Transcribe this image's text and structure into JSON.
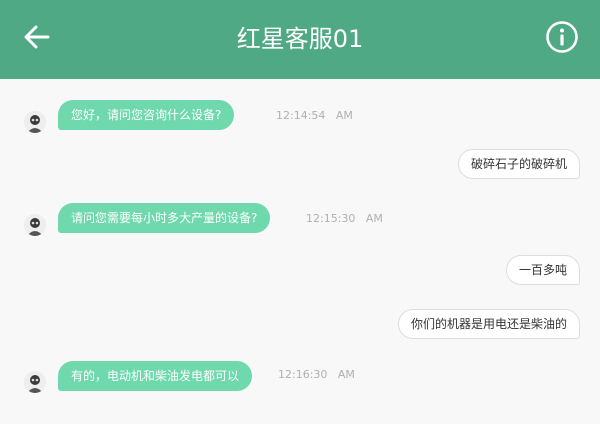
{
  "header": {
    "title": "红星客服01",
    "back_icon": "arrow-left-icon",
    "info_icon": "info-circle-icon"
  },
  "colors": {
    "header_bg": "#4fa985",
    "incoming_bubble": "#6fd8ad",
    "outgoing_bubble": "#ffffff",
    "page_bg": "#f8f8f8"
  },
  "messages": [
    {
      "from": "agent",
      "text": "您好，请问您咨询什么设备?",
      "time": "12:14:54",
      "ampm": "AM"
    },
    {
      "from": "user",
      "text": "破碎石子的破碎机"
    },
    {
      "from": "agent",
      "text": "请问您需要每小时多大产量的设备?",
      "time": "12:15:30",
      "ampm": "AM"
    },
    {
      "from": "user",
      "text": "一百多吨"
    },
    {
      "from": "user",
      "text": "你们的机器是用电还是柴油的"
    },
    {
      "from": "agent",
      "text": "有的，电动机和柴油发电都可以",
      "time": "12:16:30",
      "ampm": "AM"
    }
  ]
}
